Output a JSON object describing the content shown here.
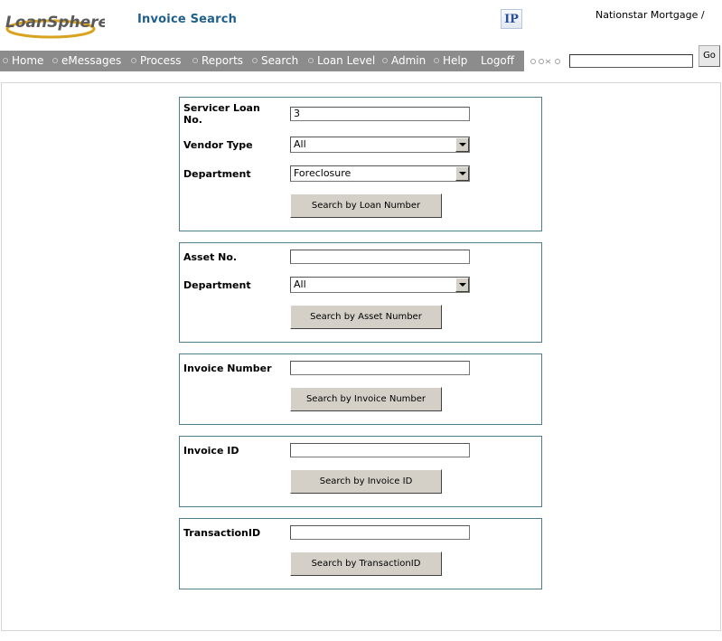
{
  "header": {
    "logo_text": "LoanSphere",
    "title": "Invoice Search",
    "ip_icon_text": "IP",
    "company": "Nationstar Mortgage /"
  },
  "nav": {
    "items": [
      "Home",
      "eMessages",
      "Process",
      "Reports",
      "Search",
      "Loan Level",
      "Admin",
      "Help",
      "Logoff"
    ],
    "search_value": "",
    "go_label": "Go"
  },
  "panels": {
    "loan": {
      "servicer_label_line1": "Servicer Loan",
      "servicer_label_line2": "No.",
      "servicer_value": "3",
      "vendor_label": "Vendor Type",
      "vendor_value": "All",
      "department_label": "Department",
      "department_value": "Foreclosure",
      "button": "Search by Loan Number"
    },
    "asset": {
      "asset_label": "Asset No.",
      "asset_value": "",
      "department_label": "Department",
      "department_value": "All",
      "button": "Search by Asset Number"
    },
    "invoice_number": {
      "label": "Invoice Number",
      "value": "",
      "button": "Search by Invoice Number"
    },
    "invoice_id": {
      "label": "Invoice ID",
      "value": "",
      "button": "Search by Invoice ID"
    },
    "transaction": {
      "label": "TransactionID",
      "value": "",
      "button": "Search by TransactionID"
    }
  },
  "colors": {
    "title": "#1f5f8b",
    "navbar": "#8c8c8c",
    "panel_border": "#4f7f8f",
    "button_face": "#d4d0c8"
  }
}
